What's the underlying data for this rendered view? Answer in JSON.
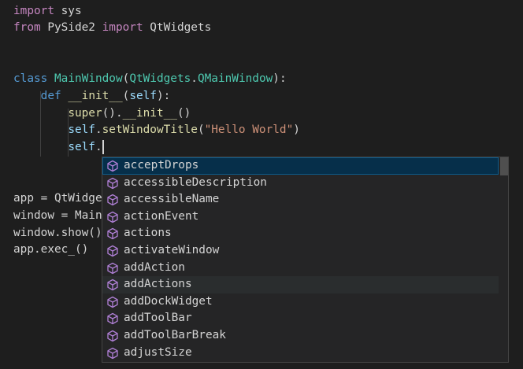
{
  "editor": {
    "lines": [
      {
        "tokens": [
          {
            "t": "import",
            "c": "kw-imp"
          },
          {
            "t": " sys",
            "c": "plain"
          }
        ]
      },
      {
        "tokens": [
          {
            "t": "from",
            "c": "kw-imp"
          },
          {
            "t": " PySide2 ",
            "c": "plain"
          },
          {
            "t": "import",
            "c": "kw-imp"
          },
          {
            "t": " QtWidgets",
            "c": "plain"
          }
        ]
      },
      {
        "tokens": []
      },
      {
        "tokens": []
      },
      {
        "tokens": [
          {
            "t": "class",
            "c": "kw"
          },
          {
            "t": " ",
            "c": "plain"
          },
          {
            "t": "MainWindow",
            "c": "cls"
          },
          {
            "t": "(",
            "c": "plain"
          },
          {
            "t": "QtWidgets",
            "c": "cls"
          },
          {
            "t": ".",
            "c": "plain"
          },
          {
            "t": "QMainWindow",
            "c": "cls"
          },
          {
            "t": "):",
            "c": "plain"
          }
        ]
      },
      {
        "tokens": [
          {
            "t": "    ",
            "c": "plain"
          },
          {
            "t": "def",
            "c": "kw"
          },
          {
            "t": " ",
            "c": "plain"
          },
          {
            "t": "__init__",
            "c": "fn"
          },
          {
            "t": "(",
            "c": "plain"
          },
          {
            "t": "self",
            "c": "var"
          },
          {
            "t": "):",
            "c": "plain"
          }
        ]
      },
      {
        "tokens": [
          {
            "t": "        ",
            "c": "plain"
          },
          {
            "t": "super",
            "c": "fn"
          },
          {
            "t": "().",
            "c": "plain"
          },
          {
            "t": "__init__",
            "c": "fn"
          },
          {
            "t": "()",
            "c": "plain"
          }
        ]
      },
      {
        "tokens": [
          {
            "t": "        ",
            "c": "plain"
          },
          {
            "t": "self",
            "c": "var"
          },
          {
            "t": ".",
            "c": "plain"
          },
          {
            "t": "setWindowTitle",
            "c": "fn"
          },
          {
            "t": "(",
            "c": "plain"
          },
          {
            "t": "\"Hello World\"",
            "c": "str"
          },
          {
            "t": ")",
            "c": "plain"
          }
        ]
      },
      {
        "tokens": [
          {
            "t": "        ",
            "c": "plain"
          },
          {
            "t": "self",
            "c": "var"
          },
          {
            "t": ".",
            "c": "plain"
          }
        ]
      },
      {
        "tokens": []
      },
      {
        "tokens": []
      },
      {
        "tokens": [
          {
            "t": "app = QtWidge",
            "c": "plain"
          }
        ]
      },
      {
        "tokens": [
          {
            "t": "window = Main",
            "c": "plain"
          }
        ]
      },
      {
        "tokens": [
          {
            "t": "window.show()",
            "c": "plain"
          }
        ]
      },
      {
        "tokens": [
          {
            "t": "app.exec_()",
            "c": "plain"
          }
        ]
      }
    ]
  },
  "suggest": {
    "items": [
      {
        "label": "acceptDrops",
        "icon": "method-cube-icon",
        "state": "selected"
      },
      {
        "label": "accessibleDescription",
        "icon": "method-cube-icon",
        "state": ""
      },
      {
        "label": "accessibleName",
        "icon": "method-cube-icon",
        "state": ""
      },
      {
        "label": "actionEvent",
        "icon": "method-cube-icon",
        "state": ""
      },
      {
        "label": "actions",
        "icon": "method-cube-icon",
        "state": ""
      },
      {
        "label": "activateWindow",
        "icon": "method-cube-icon",
        "state": ""
      },
      {
        "label": "addAction",
        "icon": "method-cube-icon",
        "state": ""
      },
      {
        "label": "addActions",
        "icon": "method-cube-icon",
        "state": "hover"
      },
      {
        "label": "addDockWidget",
        "icon": "method-cube-icon",
        "state": ""
      },
      {
        "label": "addToolBar",
        "icon": "method-cube-icon",
        "state": ""
      },
      {
        "label": "addToolBarBreak",
        "icon": "method-cube-icon",
        "state": ""
      },
      {
        "label": "adjustSize",
        "icon": "method-cube-icon",
        "state": ""
      }
    ]
  },
  "colors": {
    "background": "#1e1e1e",
    "selection": "#062f4a",
    "icon": "#b180d7"
  }
}
